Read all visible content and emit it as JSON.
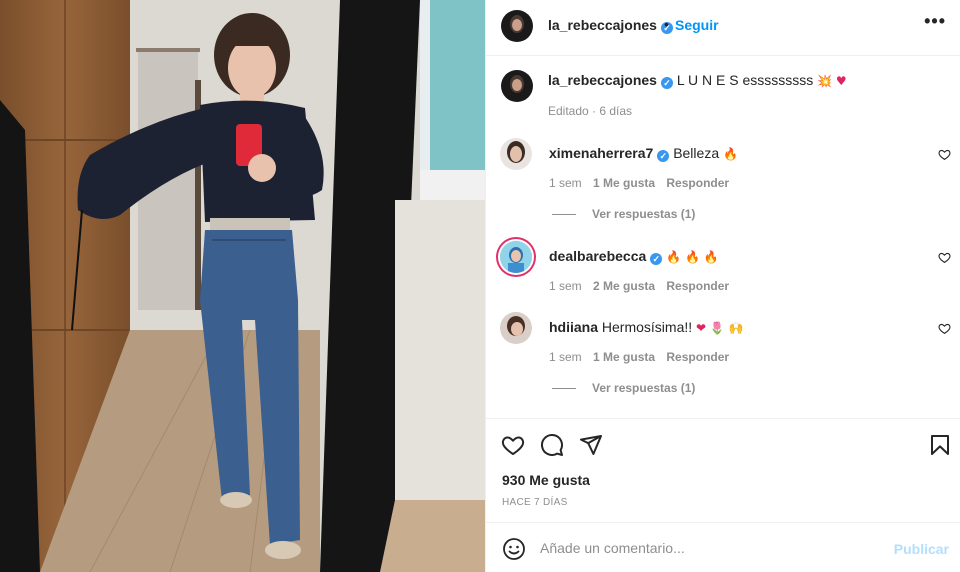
{
  "header": {
    "username": "la_rebeccajones",
    "verified_icon": "verified-badge-icon",
    "separator": "•",
    "follow_label": "Seguir",
    "more_icon": "more-options-icon",
    "more_label": "•••"
  },
  "caption": {
    "username": "la_rebeccajones",
    "text": "L U N E S esssssssss",
    "emojis": "💥 ♥",
    "edited": "Editado · 6 días"
  },
  "comments": [
    {
      "username": "ximenaherrera7",
      "verified": true,
      "text": "Belleza",
      "emojis": "🔥",
      "time": "1 sem",
      "likes": "1 Me gusta",
      "reply": "Responder",
      "view_replies": "Ver respuestas (1)"
    },
    {
      "username": "dealbarebecca",
      "verified": true,
      "text": "",
      "emojis": "🔥 🔥 🔥",
      "time": "1 sem",
      "likes": "2 Me gusta",
      "reply": "Responder"
    },
    {
      "username": "hdiiana",
      "verified": false,
      "text": "Hermosísima!!",
      "emojis": "❤ 🌷 🙌",
      "time": "1 sem",
      "likes": "1 Me gusta",
      "reply": "Responder",
      "view_replies": "Ver respuestas (1)"
    }
  ],
  "actions": {
    "like_icon": "heart-icon",
    "comment_icon": "comment-icon",
    "share_icon": "share-icon",
    "save_icon": "bookmark-icon",
    "likes_count": "930 Me gusta",
    "age": "HACE 7 DÍAS"
  },
  "add_comment": {
    "emoji_icon": "smiley-icon",
    "placeholder": "Añade un comentario...",
    "publish_label": "Publicar"
  },
  "colors": {
    "accent": "#0095f6",
    "verified": "#3897f0",
    "muted": "#8e8e8e",
    "publish_disabled": "#b2dffc"
  }
}
